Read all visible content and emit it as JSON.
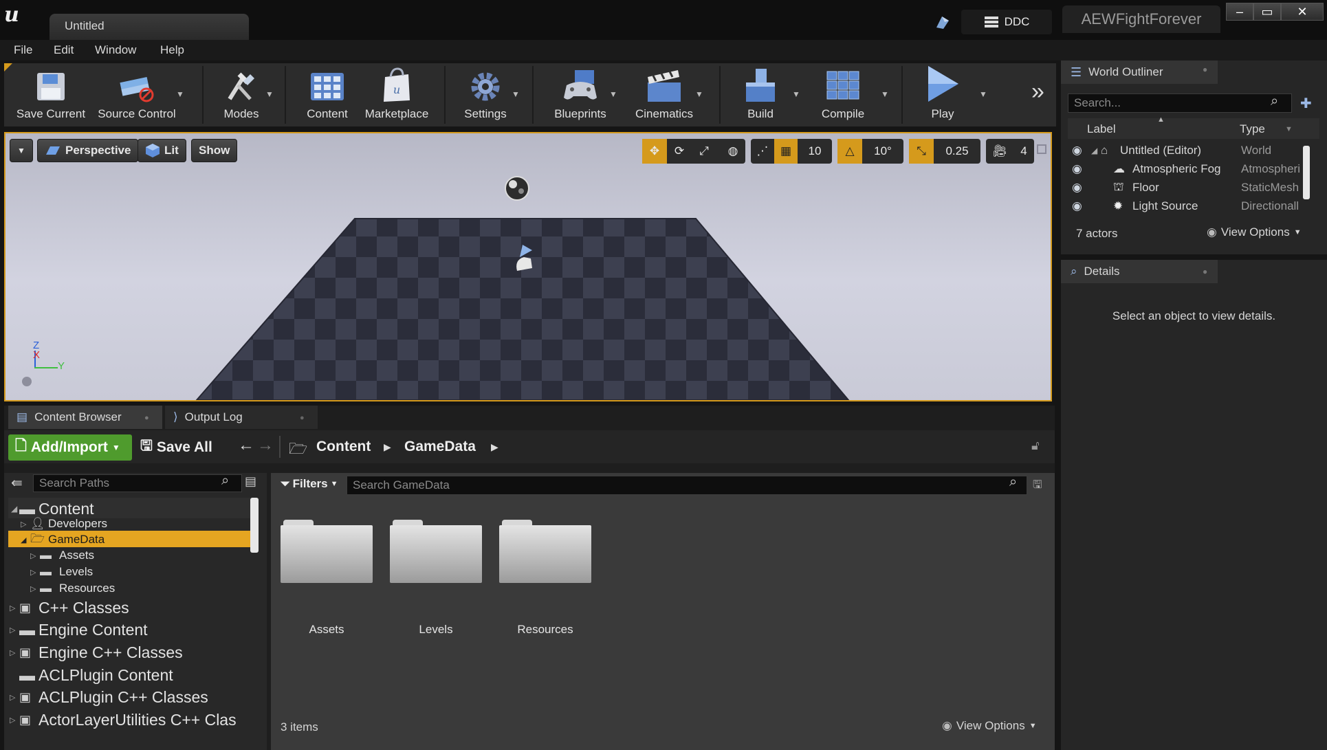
{
  "window": {
    "doc_tab": "Untitled",
    "ddc_label": "DDC",
    "project_name": "AEWFightForever",
    "minimize": "–",
    "maximize": "▭",
    "close": "✕"
  },
  "menu": [
    "File",
    "Edit",
    "Window",
    "Help"
  ],
  "toolbar": {
    "save_current": "Save Current",
    "source_control": "Source Control",
    "modes": "Modes",
    "content": "Content",
    "marketplace": "Marketplace",
    "settings": "Settings",
    "blueprints": "Blueprints",
    "cinematics": "Cinematics",
    "build": "Build",
    "compile": "Compile",
    "play": "Play",
    "more": "»"
  },
  "viewport": {
    "perspective": "Perspective",
    "lit": "Lit",
    "show": "Show",
    "grid_snap": "10",
    "rotation_snap": "10°",
    "scale_snap": "0.25",
    "camera_speed": "4",
    "axis_z": "Z",
    "axis_x": "X",
    "axis_y": "Y"
  },
  "outliner": {
    "title": "World Outliner",
    "search_placeholder": "Search...",
    "col_label": "Label",
    "col_type": "Type",
    "rows": [
      {
        "label": "Untitled (Editor)",
        "type": "World"
      },
      {
        "label": "Atmospheric Fog",
        "type": "Atmospheri"
      },
      {
        "label": "Floor",
        "type": "StaticMesh"
      },
      {
        "label": "Light Source",
        "type": "Directionall"
      }
    ],
    "actor_count": "7 actors",
    "view_options": "View Options"
  },
  "details": {
    "title": "Details",
    "empty_message": "Select an object to view details."
  },
  "content_browser": {
    "tab_label": "Content Browser",
    "output_tab_label": "Output Log",
    "add_import": "Add/Import",
    "save_all": "Save All",
    "breadcrumb": [
      "Content",
      "GameData"
    ],
    "search_paths_placeholder": "Search Paths",
    "filters": "Filters",
    "search_assets_placeholder": "Search GameData",
    "tree": [
      {
        "label": "Content",
        "level": 0,
        "root": true
      },
      {
        "label": "Developers",
        "level": 1
      },
      {
        "label": "GameData",
        "level": 1,
        "selected": true
      },
      {
        "label": "Assets",
        "level": 2
      },
      {
        "label": "Levels",
        "level": 2
      },
      {
        "label": "Resources",
        "level": 2
      },
      {
        "label": "C++ Classes",
        "level": 0,
        "root": true
      },
      {
        "label": "Engine Content",
        "level": 0,
        "root": true
      },
      {
        "label": "Engine C++ Classes",
        "level": 0,
        "root": true
      },
      {
        "label": "ACLPlugin Content",
        "level": 0,
        "root": true
      },
      {
        "label": "ACLPlugin C++ Classes",
        "level": 0,
        "root": true
      },
      {
        "label": "ActorLayerUtilities C++ Clas",
        "level": 0,
        "root": true
      }
    ],
    "folders": [
      "Assets",
      "Levels",
      "Resources"
    ],
    "item_count": "3 items",
    "view_options": "View Options"
  },
  "colors": {
    "accent_orange": "#d59a1c",
    "add_green": "#4f9b2d",
    "selected_row": "#e5a521"
  }
}
